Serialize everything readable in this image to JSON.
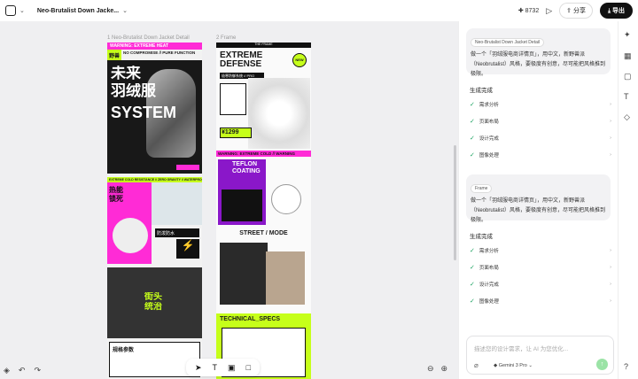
{
  "topbar": {
    "doc_title": "Neo-Brutalist Down Jacke...",
    "credits": "8732",
    "share_label": "分享",
    "export_label": "导出"
  },
  "canvas": {
    "frame1_label": "1 Neo-Brutalist Down Jacket Detail",
    "frame2_label": "2 Frame"
  },
  "poster1": {
    "warning": "WARNING: EXTREME HEAT",
    "zero": "ZERO",
    "badge": "野兽",
    "subtitle": "NO COMPROMISE // PURE FUNCTION",
    "headline1": "未来",
    "headline2": "羽绒服",
    "headline3": "SYSTEM",
    "ticker": "EXTREME COLD RESISTANCE // ZERO GRAVITY // WATERPROOF",
    "feature1": "热能",
    "feature2": "锁死",
    "tag_water": "防泼防水",
    "tag_hot": "FIG",
    "city1": "街头",
    "city2": "统治",
    "specs_title": "规格参数"
  },
  "poster2": {
    "header": "THE FRAME",
    "headline1": "EXTREME",
    "headline2": "DEFENSE",
    "badge": "NEW",
    "subtitle": "极寒防御系统 // PRO",
    "price": "¥1299",
    "warning": "WARNING: EXTREME COLD // WARNING",
    "teflon1": "TEFLON",
    "teflon2": "COATING",
    "street": "STREET / MODE",
    "tech": "TECHNICAL_SPECS"
  },
  "panel": {
    "msg1_tag": "Neo-Brutalist Down Jacket Detail",
    "msg1": "做一个「羽绒服电商详情页」，用中文，新野兽派（Neobrutalist）风格，要极度有创意，尽可能把风格推到极限。",
    "done1": "生成完成",
    "steps1": [
      "需求分析",
      "页面布局",
      "设计完成",
      "图像处理"
    ],
    "msg2_tag": "Frame",
    "msg2": "做一个「羽绒服电商详情页」，用中文，新野兽派（Neobrutalist）风格，要极度有创意，尽可能把风格推到极限。",
    "done2": "生成完成",
    "steps2": [
      "需求分析",
      "页面布局",
      "设计完成",
      "图像处理"
    ],
    "input_placeholder": "描述您的设计需求，让 AI 为您优化...",
    "model": "Gemini 3 Pro"
  },
  "icons": [
    "search-icon",
    "chevron-down-icon",
    "plus-icon",
    "play-icon",
    "share-icon",
    "export-icon",
    "magic-icon",
    "grid-icon",
    "image-icon",
    "text-icon",
    "layers-icon",
    "help-icon"
  ],
  "colors": {
    "accent_pink": "#ff2bd6",
    "accent_lime": "#c6ff1a",
    "black": "#111111"
  }
}
